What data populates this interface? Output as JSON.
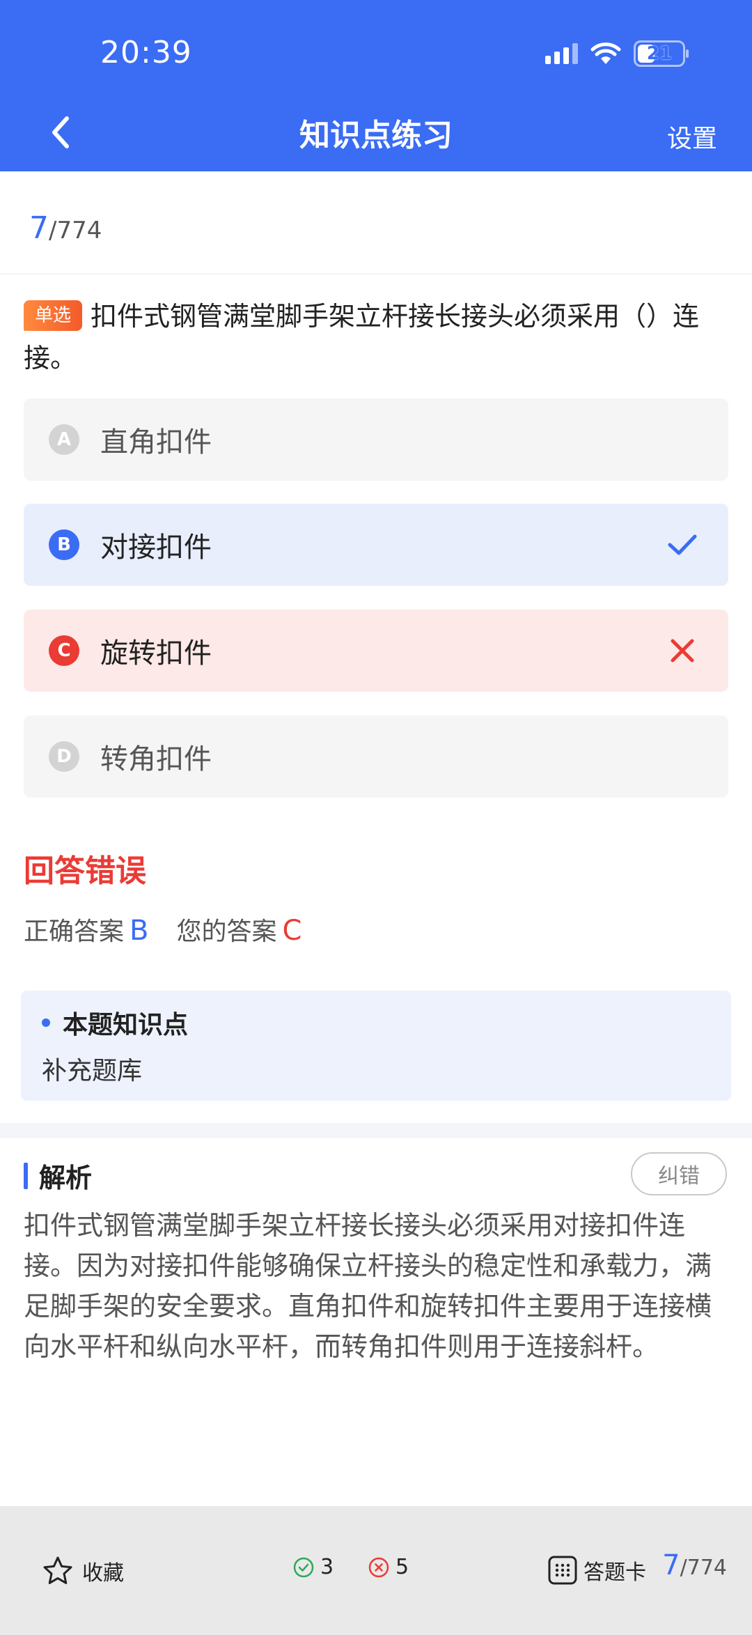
{
  "status_bar": {
    "time": "20:39",
    "battery": "21"
  },
  "nav": {
    "title": "知识点练习",
    "settings_label": "设置"
  },
  "progress": {
    "current": "7",
    "total": "/774"
  },
  "question": {
    "type_tag": "单选",
    "text": "扣件式钢管满堂脚手架立杆接长接头必须采用（）连接。"
  },
  "options": [
    {
      "letter": "A",
      "text": "直角扣件",
      "state": "normal"
    },
    {
      "letter": "B",
      "text": "对接扣件",
      "state": "correct"
    },
    {
      "letter": "C",
      "text": "旋转扣件",
      "state": "wrong"
    },
    {
      "letter": "D",
      "text": "转角扣件",
      "state": "normal"
    }
  ],
  "result": {
    "title": "回答错误",
    "correct_label": "正确答案",
    "correct_value": "B",
    "your_label": "您的答案",
    "your_value": "C"
  },
  "knowledge": {
    "title": "本题知识点",
    "value": "补充题库"
  },
  "analysis": {
    "title": "解析",
    "report_label": "纠错",
    "text": "扣件式钢管满堂脚手架立杆接长接头必须采用对接扣件连接。因为对接扣件能够确保立杆接头的稳定性和承载力，满足脚手架的安全要求。直角扣件和旋转扣件主要用于连接横向水平杆和纵向水平杆，而转角扣件则用于连接斜杆。"
  },
  "bottom_bar": {
    "favorite_label": "收藏",
    "right_count": "3",
    "wrong_count": "5",
    "card_label": "答题卡",
    "current": "7",
    "total": "/774"
  },
  "colors": {
    "primary": "#3a6cf4",
    "error": "#ea3b35",
    "correct_bg": "#e8eefc",
    "wrong_bg": "#fde9e7",
    "tag": "#f45a2a"
  }
}
